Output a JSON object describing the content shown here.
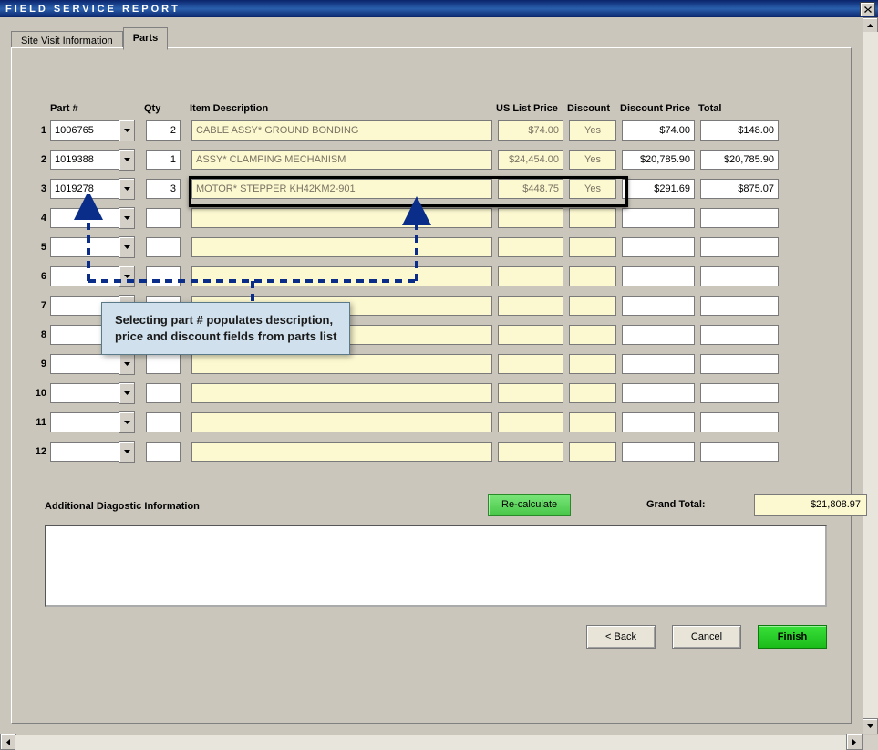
{
  "window": {
    "title": "FIELD SERVICE REPORT"
  },
  "tabs": {
    "site_visit": "Site Visit Information",
    "parts": "Parts"
  },
  "headers": {
    "part": "Part #",
    "qty": "Qty",
    "desc": "Item Description",
    "price": "US List Price",
    "discount": "Discount",
    "dprice": "Discount Price",
    "total": "Total"
  },
  "rows": [
    {
      "n": "1",
      "part": "1006765",
      "qty": "2",
      "desc": "CABLE ASSY* GROUND BONDING",
      "price": "$74.00",
      "disc": "Yes",
      "dprice": "$74.00",
      "total": "$148.00"
    },
    {
      "n": "2",
      "part": "1019388",
      "qty": "1",
      "desc": "ASSY* CLAMPING MECHANISM",
      "price": "$24,454.00",
      "disc": "Yes",
      "dprice": "$20,785.90",
      "total": "$20,785.90"
    },
    {
      "n": "3",
      "part": "1019278",
      "qty": "3",
      "desc": "MOTOR* STEPPER KH42KM2-901",
      "price": "$448.75",
      "disc": "Yes",
      "dprice": "$291.69",
      "total": "$875.07"
    },
    {
      "n": "4",
      "part": "",
      "qty": "",
      "desc": "",
      "price": "",
      "disc": "",
      "dprice": "",
      "total": ""
    },
    {
      "n": "5",
      "part": "",
      "qty": "",
      "desc": "",
      "price": "",
      "disc": "",
      "dprice": "",
      "total": ""
    },
    {
      "n": "6",
      "part": "",
      "qty": "",
      "desc": "",
      "price": "",
      "disc": "",
      "dprice": "",
      "total": ""
    },
    {
      "n": "7",
      "part": "",
      "qty": "",
      "desc": "",
      "price": "",
      "disc": "",
      "dprice": "",
      "total": ""
    },
    {
      "n": "8",
      "part": "",
      "qty": "",
      "desc": "",
      "price": "",
      "disc": "",
      "dprice": "",
      "total": ""
    },
    {
      "n": "9",
      "part": "",
      "qty": "",
      "desc": "",
      "price": "",
      "disc": "",
      "dprice": "",
      "total": ""
    },
    {
      "n": "10",
      "part": "",
      "qty": "",
      "desc": "",
      "price": "",
      "disc": "",
      "dprice": "",
      "total": ""
    },
    {
      "n": "11",
      "part": "",
      "qty": "",
      "desc": "",
      "price": "",
      "disc": "",
      "dprice": "",
      "total": ""
    },
    {
      "n": "12",
      "part": "",
      "qty": "",
      "desc": "",
      "price": "",
      "disc": "",
      "dprice": "",
      "total": ""
    }
  ],
  "callout": {
    "line1": "Selecting part # populates description,",
    "line2": "price and discount fields from parts list"
  },
  "footer": {
    "recalc": "Re-calculate",
    "grand_total_label": "Grand Total:",
    "grand_total_value": "$21,808.97",
    "additional_label": "Additional Diagostic Information",
    "back": "< Back",
    "cancel": "Cancel",
    "finish": "Finish"
  }
}
